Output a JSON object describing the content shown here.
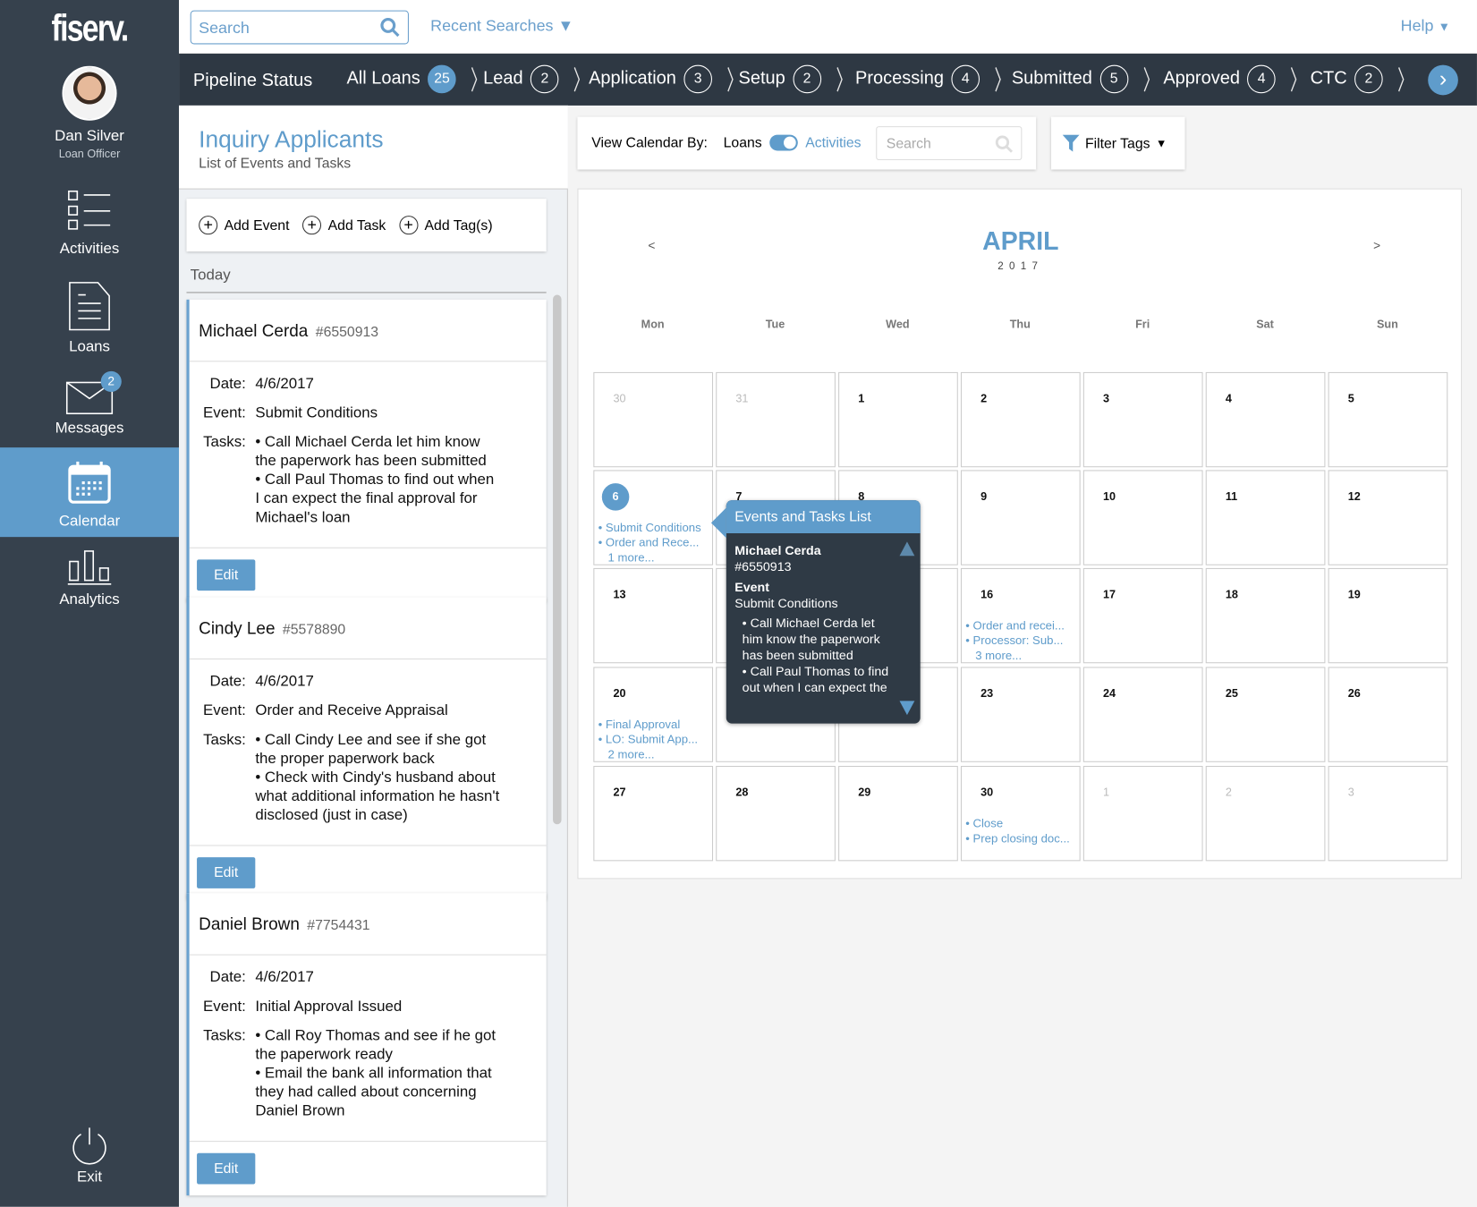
{
  "brand": {
    "logo": "fiserv."
  },
  "user": {
    "name": "Dan Silver",
    "role": "Loan Officer"
  },
  "nav": [
    {
      "label": "Activities",
      "icon": "checklist-icon"
    },
    {
      "label": "Loans",
      "icon": "document-icon"
    },
    {
      "label": "Messages",
      "icon": "envelope-icon",
      "badge": "2"
    },
    {
      "label": "Calendar",
      "icon": "calendar-icon",
      "active": true
    },
    {
      "label": "Analytics",
      "icon": "bar-chart-icon"
    }
  ],
  "exit": {
    "label": "Exit",
    "icon": "power-icon"
  },
  "topbar": {
    "search_placeholder": "Search",
    "recent": "Recent Searches",
    "help": "Help"
  },
  "pipeline": {
    "title": "Pipeline Status",
    "stages": [
      {
        "label": "All Loans",
        "count": "25",
        "active": true
      },
      {
        "label": "Lead",
        "count": "2"
      },
      {
        "label": "Application",
        "count": "3"
      },
      {
        "label": "Setup",
        "count": "2"
      },
      {
        "label": "Processing",
        "count": "4"
      },
      {
        "label": "Submitted",
        "count": "5"
      },
      {
        "label": "Approved",
        "count": "4"
      },
      {
        "label": "CTC",
        "count": "2"
      }
    ]
  },
  "left": {
    "title": "Inquiry Applicants",
    "subtitle": "List of Events and Tasks",
    "actions": [
      "Add Event",
      "Add Task",
      "Add Tag(s)"
    ],
    "section": "Today",
    "labels": {
      "date": "Date:",
      "event": "Event:",
      "tasks": "Tasks:",
      "edit": "Edit"
    },
    "cards": [
      {
        "name": "Michael Cerda",
        "id": "#6550913",
        "date": "4/6/2017",
        "event": "Submit Conditions",
        "tasks": [
          "• Call Michael Cerda let him know",
          "the paperwork has been submitted",
          "• Call Paul Thomas to find out when",
          "I can expect the final approval for",
          "Michael's loan"
        ]
      },
      {
        "name": "Cindy Lee",
        "id": "#5578890",
        "date": "4/6/2017",
        "event": "Order and Receive Appraisal",
        "tasks": [
          "• Call Cindy Lee and see if she got",
          "the proper paperwork back",
          "• Check with Cindy's husband about",
          "what additional information he hasn't",
          "disclosed (just in case)"
        ]
      },
      {
        "name": "Daniel Brown",
        "id": "#7754431",
        "date": "4/6/2017",
        "event": "Initial Approval Issued",
        "tasks": [
          "• Call Roy Thomas and see if he got",
          "the paperwork ready",
          "• Email the bank all information that",
          "they had called about concerning",
          "Daniel Brown"
        ]
      }
    ]
  },
  "calendar": {
    "view_by": "View Calendar By:",
    "toggle_left": "Loans",
    "toggle_right": "Activities",
    "toggle_value": "Activities",
    "search_placeholder": "Search",
    "filter": "Filter Tags",
    "month": "APRIL",
    "year": "2017",
    "prev": "<",
    "next": ">",
    "days": [
      "Mon",
      "Tue",
      "Wed",
      "Thu",
      "Fri",
      "Sat",
      "Sun"
    ],
    "weeks": [
      [
        {
          "d": "30",
          "muted": true
        },
        {
          "d": "31",
          "muted": true
        },
        {
          "d": "1"
        },
        {
          "d": "2"
        },
        {
          "d": "3"
        },
        {
          "d": "4"
        },
        {
          "d": "5"
        }
      ],
      [
        {
          "d": "6",
          "selected": true,
          "events": [
            "• Submit Conditions",
            "• Order and Rece...",
            "   1 more..."
          ]
        },
        {
          "d": "7"
        },
        {
          "d": "8"
        },
        {
          "d": "9"
        },
        {
          "d": "10"
        },
        {
          "d": "11"
        },
        {
          "d": "12"
        }
      ],
      [
        {
          "d": "13"
        },
        {
          "d": ""
        },
        {
          "d": ""
        },
        {
          "d": "16",
          "events": [
            "• Order and recei...",
            "• Processor: Sub...",
            "   3 more..."
          ]
        },
        {
          "d": "17"
        },
        {
          "d": "18"
        },
        {
          "d": "19"
        }
      ],
      [
        {
          "d": "20",
          "events": [
            "• Final Approval",
            "• LO: Submit App...",
            "   2 more..."
          ]
        },
        {
          "d": ""
        },
        {
          "d": ""
        },
        {
          "d": "23"
        },
        {
          "d": "24"
        },
        {
          "d": "25"
        },
        {
          "d": "26"
        }
      ],
      [
        {
          "d": "27"
        },
        {
          "d": "28"
        },
        {
          "d": "29"
        },
        {
          "d": "30",
          "events": [
            "• Close",
            "• Prep closing doc..."
          ]
        },
        {
          "d": "1",
          "muted": true
        },
        {
          "d": "2",
          "muted": true
        },
        {
          "d": "3",
          "muted": true
        }
      ]
    ],
    "popover": {
      "title": "Events and Tasks List",
      "name": "Michael Cerda",
      "id": "#6550913",
      "event_label": "Event",
      "event": "Submit Conditions",
      "tasks": [
        "• Call Michael Cerda let him know the paperwork has been submitted",
        "• Call Paul Thomas to find out when I can expect the"
      ]
    }
  },
  "colors": {
    "accent": "#5f9ccb",
    "sidebar": "#36414d",
    "pipeline": "#2e3843",
    "popover": "#2f3a45"
  }
}
